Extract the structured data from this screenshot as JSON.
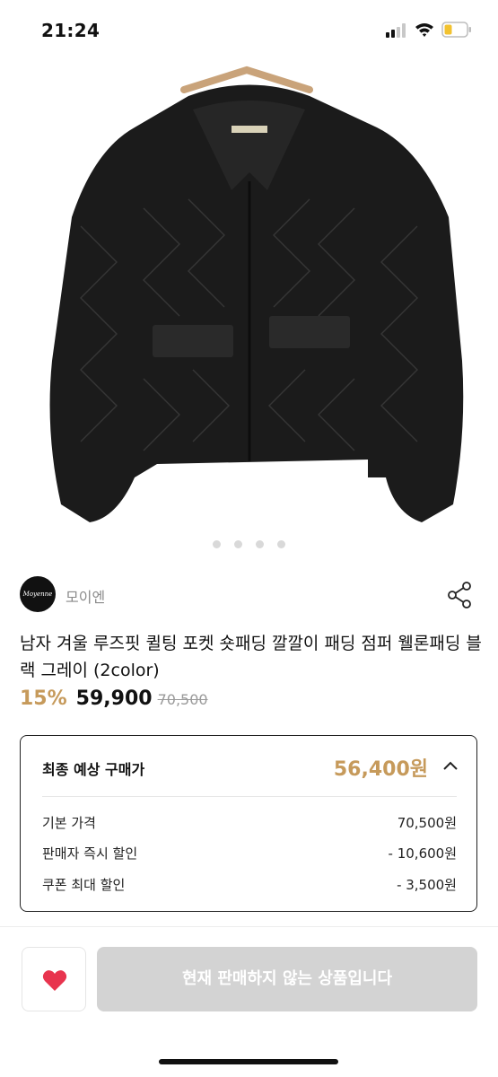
{
  "status_bar": {
    "time": "21:24",
    "icons": [
      "signal-icon",
      "wifi-icon",
      "battery-icon"
    ]
  },
  "product": {
    "image_icon": "black-quilted-jacket-photo",
    "carousel_pages": 4,
    "seller": {
      "name": "모이엔",
      "avatar_text": "Moyenne"
    },
    "title": "남자 겨울 루즈핏 퀼팅 포켓 숏패딩 깔깔이 패딩 점퍼 웰론패딩 블랙 그레이 (2color)",
    "discount": "15%",
    "price": "59,900",
    "original_price": "70,500"
  },
  "estimate": {
    "label": "최종 예상 구매가",
    "total": "56,400원",
    "lines": [
      {
        "label": "기본 가격",
        "value": "70,500원"
      },
      {
        "label": "판매자 즉시 할인",
        "value": "- 10,600원"
      },
      {
        "label": "쿠폰 최대 할인",
        "value": "- 3,500원"
      }
    ]
  },
  "bottom_bar": {
    "like_icon": "heart-icon",
    "buy_label": "현재 판매하지 않는 상품입니다"
  },
  "colors": {
    "accent": "#c69a5b",
    "heart": "#e8344e",
    "disabled_button": "#d3d3d3"
  }
}
